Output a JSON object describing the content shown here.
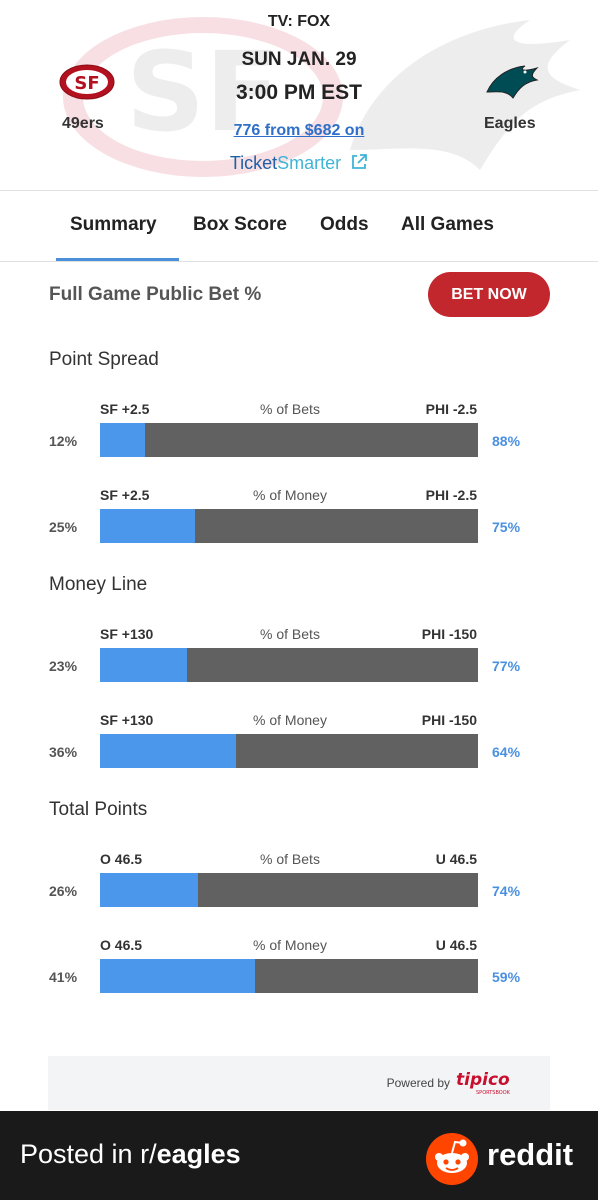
{
  "header": {
    "tv": "TV: FOX",
    "date": "SUN JAN. 29",
    "time": "3:00 PM EST",
    "tickets_link": "776 from $682 on",
    "ticket_brand_a": "Ticket",
    "ticket_brand_b": "Smarter",
    "home_team": "49ers",
    "away_team": "Eagles",
    "home_logo_text": "SF"
  },
  "tabs": [
    {
      "label": "Summary",
      "active": true
    },
    {
      "label": "Box Score",
      "active": false
    },
    {
      "label": "Odds",
      "active": false
    },
    {
      "label": "All Games",
      "active": false
    }
  ],
  "section": {
    "title": "Full Game Public Bet %",
    "cta": "BET NOW"
  },
  "groups": [
    {
      "title": "Point Spread",
      "rows": [
        {
          "left": "SF +2.5",
          "mid": "% of Bets",
          "right": "PHI -2.5",
          "left_pct": "12%",
          "right_pct": "88%",
          "value": 12
        },
        {
          "left": "SF +2.5",
          "mid": "% of Money",
          "right": "PHI -2.5",
          "left_pct": "25%",
          "right_pct": "75%",
          "value": 25
        }
      ]
    },
    {
      "title": "Money Line",
      "rows": [
        {
          "left": "SF +130",
          "mid": "% of Bets",
          "right": "PHI -150",
          "left_pct": "23%",
          "right_pct": "77%",
          "value": 23
        },
        {
          "left": "SF +130",
          "mid": "% of Money",
          "right": "PHI -150",
          "left_pct": "36%",
          "right_pct": "64%",
          "value": 36
        }
      ]
    },
    {
      "title": "Total Points",
      "rows": [
        {
          "left": "O 46.5",
          "mid": "% of Bets",
          "right": "U 46.5",
          "left_pct": "26%",
          "right_pct": "74%",
          "value": 26
        },
        {
          "left": "O 46.5",
          "mid": "% of Money",
          "right": "U 46.5",
          "left_pct": "41%",
          "right_pct": "59%",
          "value": 41
        }
      ]
    }
  ],
  "powered": {
    "label": "Powered by",
    "brand": "tipico",
    "sub": "SPORTSBOOK"
  },
  "footer": {
    "posted_prefix": "Posted in r/",
    "subreddit": "eagles",
    "brand": "reddit"
  },
  "colors": {
    "accent_blue": "#4a97ec",
    "bar_gray": "#616161",
    "cta_red": "#c1272d",
    "tab_underline": "#4a90d9"
  }
}
